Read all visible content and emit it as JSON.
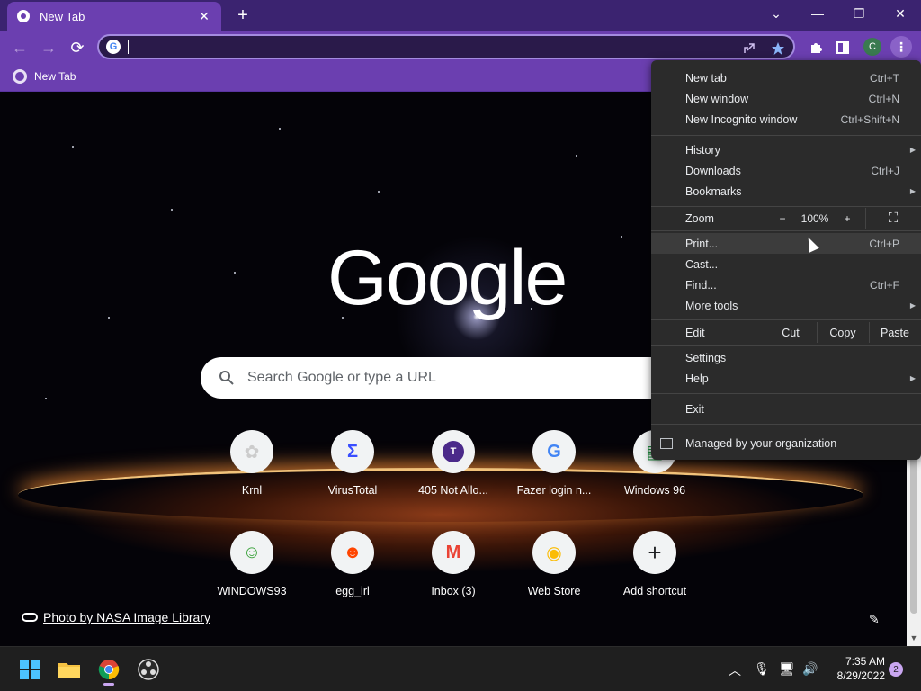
{
  "window": {
    "tab_title": "New Tab",
    "tab_close": "✕",
    "new_tab": "+",
    "controls": {
      "search_tabs": "⌄",
      "minimize": "—",
      "restore": "❐",
      "close": "✕"
    }
  },
  "toolbar": {
    "back": "←",
    "forward": "→",
    "reload": "⟳",
    "address_value": "",
    "google_g": "G",
    "avatar_letter": "C",
    "menu": "⋮"
  },
  "bookmarks": [
    {
      "label": "New Tab"
    }
  ],
  "page": {
    "logo": "Google",
    "search_placeholder": "Search Google or type a URL",
    "shortcuts": [
      {
        "label": "Krnl",
        "glyph": "✿"
      },
      {
        "label": "VirusTotal",
        "glyph": "Σ"
      },
      {
        "label": "405 Not Allo...",
        "glyph": "T"
      },
      {
        "label": "Fazer login n...",
        "glyph": "G"
      },
      {
        "label": "Windows 96",
        "glyph": "▤"
      },
      {
        "label": "WINDOWS93",
        "glyph": "☺"
      },
      {
        "label": "egg_irl",
        "glyph": "☻"
      },
      {
        "label": "Inbox (3)",
        "glyph": "M"
      },
      {
        "label": "Web Store",
        "glyph": "◉"
      },
      {
        "label": "Add shortcut",
        "glyph": "+"
      }
    ],
    "photo_credit": "Photo by NASA Image Library",
    "customize_icon": "✎"
  },
  "menu": {
    "items": [
      {
        "label": "New tab",
        "shortcut": "Ctrl+T"
      },
      {
        "label": "New window",
        "shortcut": "Ctrl+N"
      },
      {
        "label": "New Incognito window",
        "shortcut": "Ctrl+Shift+N"
      },
      {
        "label": "History",
        "shortcut": ""
      },
      {
        "label": "Downloads",
        "shortcut": "Ctrl+J"
      },
      {
        "label": "Bookmarks",
        "shortcut": ""
      },
      {
        "label": "Print...",
        "shortcut": "Ctrl+P"
      },
      {
        "label": "Cast...",
        "shortcut": ""
      },
      {
        "label": "Find...",
        "shortcut": "Ctrl+F"
      },
      {
        "label": "More tools",
        "shortcut": ""
      },
      {
        "label": "Settings",
        "shortcut": ""
      },
      {
        "label": "Help",
        "shortcut": ""
      },
      {
        "label": "Exit",
        "shortcut": ""
      }
    ],
    "zoom": {
      "label": "Zoom",
      "minus": "−",
      "level": "100%",
      "plus": "+",
      "fullscreen": "⛶"
    },
    "edit": {
      "label": "Edit",
      "cut": "Cut",
      "copy": "Copy",
      "paste": "Paste"
    },
    "managed": "Managed by your organization"
  },
  "taskbar": {
    "time": "7:35 AM",
    "date": "8/29/2022",
    "notifications": "2",
    "tray": {
      "chevron": "︿",
      "mic": "🎙",
      "network": "🖥",
      "volume": "🔊"
    }
  },
  "colors": {
    "frame": "#3b2370",
    "toolbar": "#6b3fb0",
    "menu_bg": "#2b2b2b",
    "taskbar": "#1f1f1f"
  }
}
